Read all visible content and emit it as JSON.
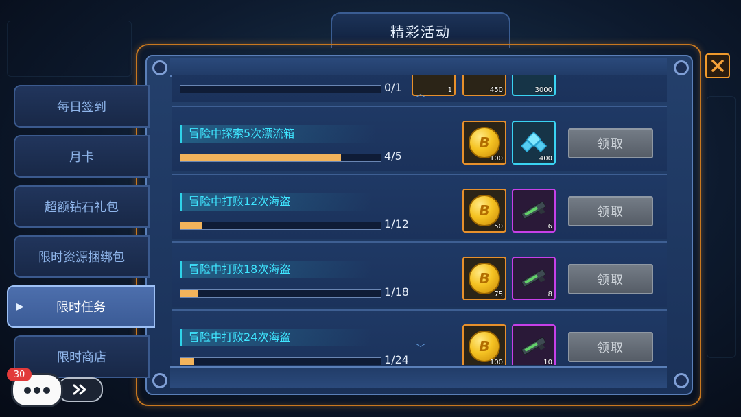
{
  "header": {
    "title": "精彩活动"
  },
  "sidebar": {
    "items": [
      {
        "label": "每日签到"
      },
      {
        "label": "月卡"
      },
      {
        "label": "超额钻石礼包"
      },
      {
        "label": "限时资源捆绑包"
      },
      {
        "label": "限时任务",
        "active": true
      },
      {
        "label": "限时商店"
      }
    ]
  },
  "tasks": [
    {
      "name": "",
      "progress_text": "0/1",
      "progress": 0.0,
      "rewards": [
        {
          "type": "item",
          "qty": "1"
        },
        {
          "type": "coin",
          "qty": "450"
        },
        {
          "type": "crystal",
          "qty": "3000"
        }
      ]
    },
    {
      "name": "冒险中探索5次漂流箱",
      "progress_text": "4/5",
      "progress": 0.8,
      "rewards": [
        {
          "type": "coin",
          "qty": "100"
        },
        {
          "type": "crystal",
          "qty": "400"
        }
      ],
      "button": "领取"
    },
    {
      "name": "冒险中打败12次海盗",
      "progress_text": "1/12",
      "progress": 0.083,
      "rewards": [
        {
          "type": "coin",
          "qty": "50"
        },
        {
          "type": "gun",
          "qty": "6"
        }
      ],
      "button": "领取"
    },
    {
      "name": "冒险中打败18次海盗",
      "progress_text": "1/18",
      "progress": 0.056,
      "rewards": [
        {
          "type": "coin",
          "qty": "75"
        },
        {
          "type": "gun",
          "qty": "8"
        }
      ],
      "button": "领取"
    },
    {
      "name": "冒险中打败24次海盗",
      "progress_text": "1/24",
      "progress": 0.042,
      "rewards": [
        {
          "type": "coin",
          "qty": "100"
        },
        {
          "type": "gun",
          "qty": "10"
        }
      ],
      "button": "领取"
    }
  ],
  "coin_glyph": "B",
  "chat": {
    "badge": "30"
  },
  "colors": {
    "accent_orange": "#e7902c",
    "task_text": "#3fe6ff",
    "progress": "#f2b35b"
  },
  "icons": [
    "close-icon",
    "chevron-right-icon",
    "chevron-up-icon",
    "chevron-down-icon",
    "coin-icon",
    "crystal-icon",
    "gun-icon",
    "chat-icon",
    "fast-forward-icon"
  ]
}
